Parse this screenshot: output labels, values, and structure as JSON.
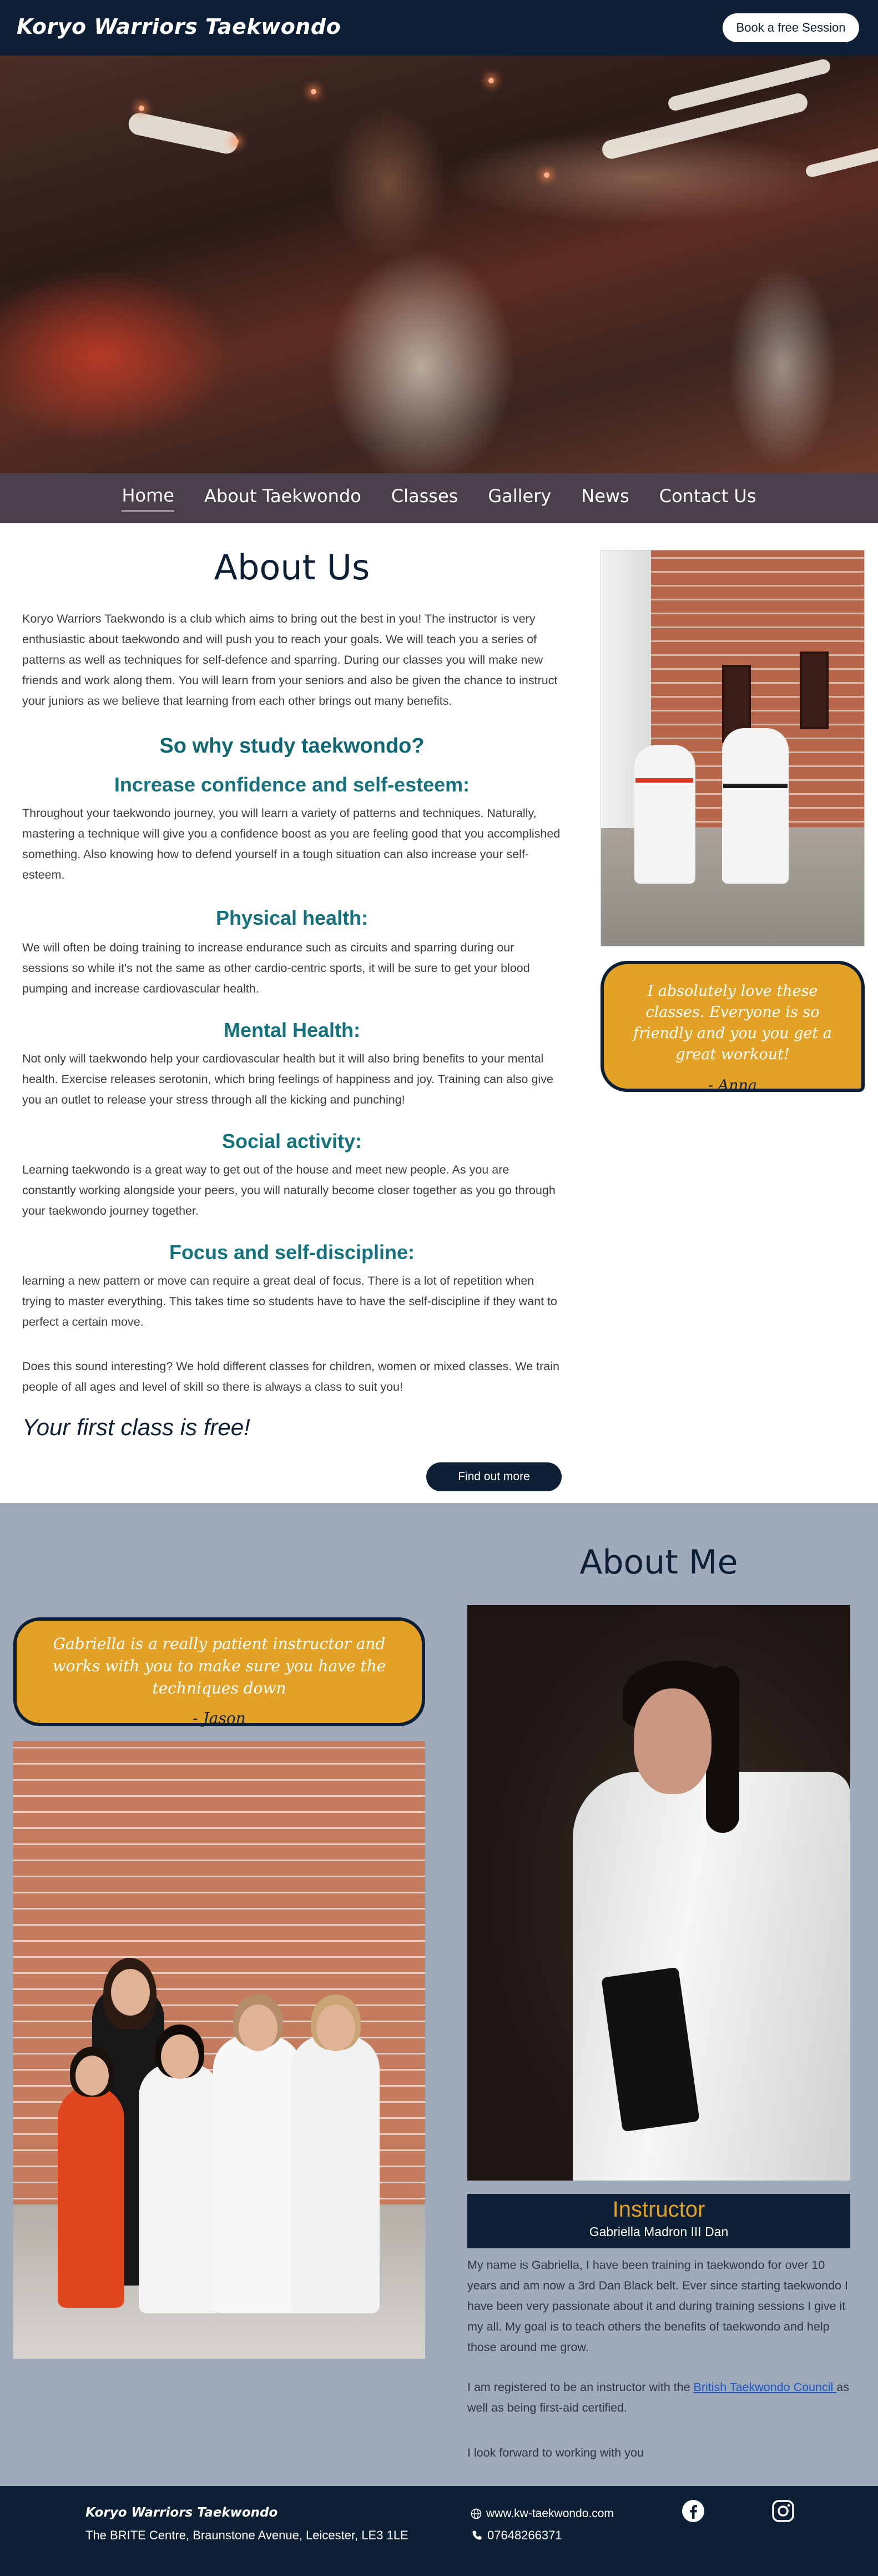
{
  "header": {
    "brand": "Koryo Warriors Taekwondo",
    "book_button": "Book a free Session"
  },
  "nav": {
    "items": [
      {
        "label": "Home"
      },
      {
        "label": "About Taekwondo"
      },
      {
        "label": "Classes"
      },
      {
        "label": "Gallery"
      },
      {
        "label": "News"
      },
      {
        "label": "Contact Us"
      }
    ],
    "active": "Home"
  },
  "about": {
    "title": "About Us",
    "intro": "Koryo Warriors Taekwondo is a club which aims to bring out the best in you! The instructor is very enthusiastic about taekwondo and will push you to reach your goals. We will teach you a series of patterns as well as techniques for self-defence and sparring. During our classes you will make new friends and work along them. You will learn from your seniors and also be given the chance to instruct your juniors as we believe that learning from each other brings out many benefits.",
    "why_title": "So why study taekwondo?",
    "sections": [
      {
        "heading": "Increase confidence and self-esteem:",
        "text": "Throughout your taekwondo journey, you will learn a variety of patterns and techniques. Naturally, mastering a technique will give you a confidence boost as you are feeling good that you accomplished something. Also knowing how to defend yourself in a tough situation can also increase your self-esteem."
      },
      {
        "heading": "Physical health:",
        "text": "We will often be doing training to increase endurance such as circuits and sparring during our sessions so while it's not the same as other cardio-centric sports, it will be sure to get your blood pumping and increase cardiovascular health."
      },
      {
        "heading": "Mental Health:",
        "text": "Not only will taekwondo help your cardiovascular health but it will also bring benefits to your mental health. Exercise releases serotonin, which bring feelings of happiness and joy. Training can also give you an outlet to release your stress through all the kicking and punching!"
      },
      {
        "heading": "Social activity:",
        "text": "Learning taekwondo is a great way to get out of the house and meet new people. As you are constantly working alongside your peers, you will naturally become closer together as you go through your taekwondo journey together."
      },
      {
        "heading": "Focus and self-discipline:",
        "text": "learning a new pattern or move can require a great deal of focus. There is a lot of repetition when trying to master everything. This takes time so students have to have the self-discipline if they want to perfect a certain move."
      }
    ],
    "closing": "Does this sound interesting? We hold different classes for children, women or mixed classes. We train people of all ages and level of skill so there is always a class to suit you!",
    "free_class": "Your first class is free!",
    "find_out_button": "Find out more"
  },
  "testimonials": {
    "anna": {
      "quote": "I absolutely love these classes. Everyone is so friendly and you you get a great workout!",
      "author": "- Anna"
    },
    "jason": {
      "quote": "Gabriella is a really patient instructor and works with you to make sure you have the techniques down",
      "author": "- Jason"
    }
  },
  "about_me": {
    "title": "About Me",
    "role": "Instructor",
    "name": "Gabriella Madron III Dan",
    "bio": "My name is Gabriella, I have been training in taekwondo for over 10 years and am now a 3rd Dan Black belt. Ever since starting taekwondo I have been very passionate about it and during training sessions I give it my all. My goal is to teach others the benefits of taekwondo and help those around me grow.",
    "registered_before": "I am registered to be an instructor with the ",
    "registered_link": "British Taekwondo Council ",
    "registered_after": "as well as being first-aid certified.",
    "closing": "I look forward to working with you"
  },
  "footer": {
    "brand": "Koryo Warriors Taekwondo",
    "address": "The BRITE Centre, Braunstone Avenue, Leicester, LE3 1LE",
    "website": "www.kw-taekwondo.com",
    "phone": "07648266371",
    "icons": [
      "globe-icon",
      "phone-icon",
      "facebook-icon",
      "instagram-icon"
    ]
  },
  "colors": {
    "navy": "#0c1f35",
    "teal": "#13727c",
    "gold": "#e3a126",
    "nav_bg": "#4a3f4a",
    "about_me_bg": "#9faabb"
  }
}
